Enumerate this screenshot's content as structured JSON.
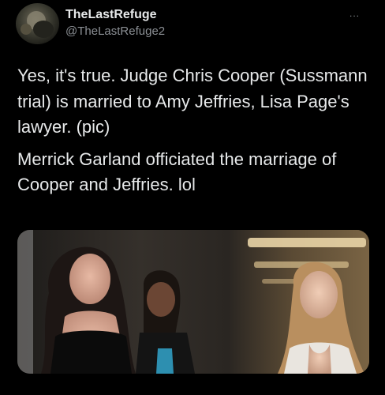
{
  "tweet": {
    "display_name": "TheLastRefuge",
    "handle": "@TheLastRefuge2",
    "more_icon": "more-dots-icon",
    "paragraphs": [
      "Yes, it's true.  Judge Chris Cooper (Sussmann trial) is married to Amy Jeffries, Lisa Page's lawyer. (pic)",
      "Merrick Garland officiated the marriage of Cooper and Jeffries. lol"
    ],
    "more_label": "..."
  },
  "colors": {
    "background": "#000000",
    "text_primary": "#e7e9ea",
    "text_secondary": "#8b8f94"
  }
}
